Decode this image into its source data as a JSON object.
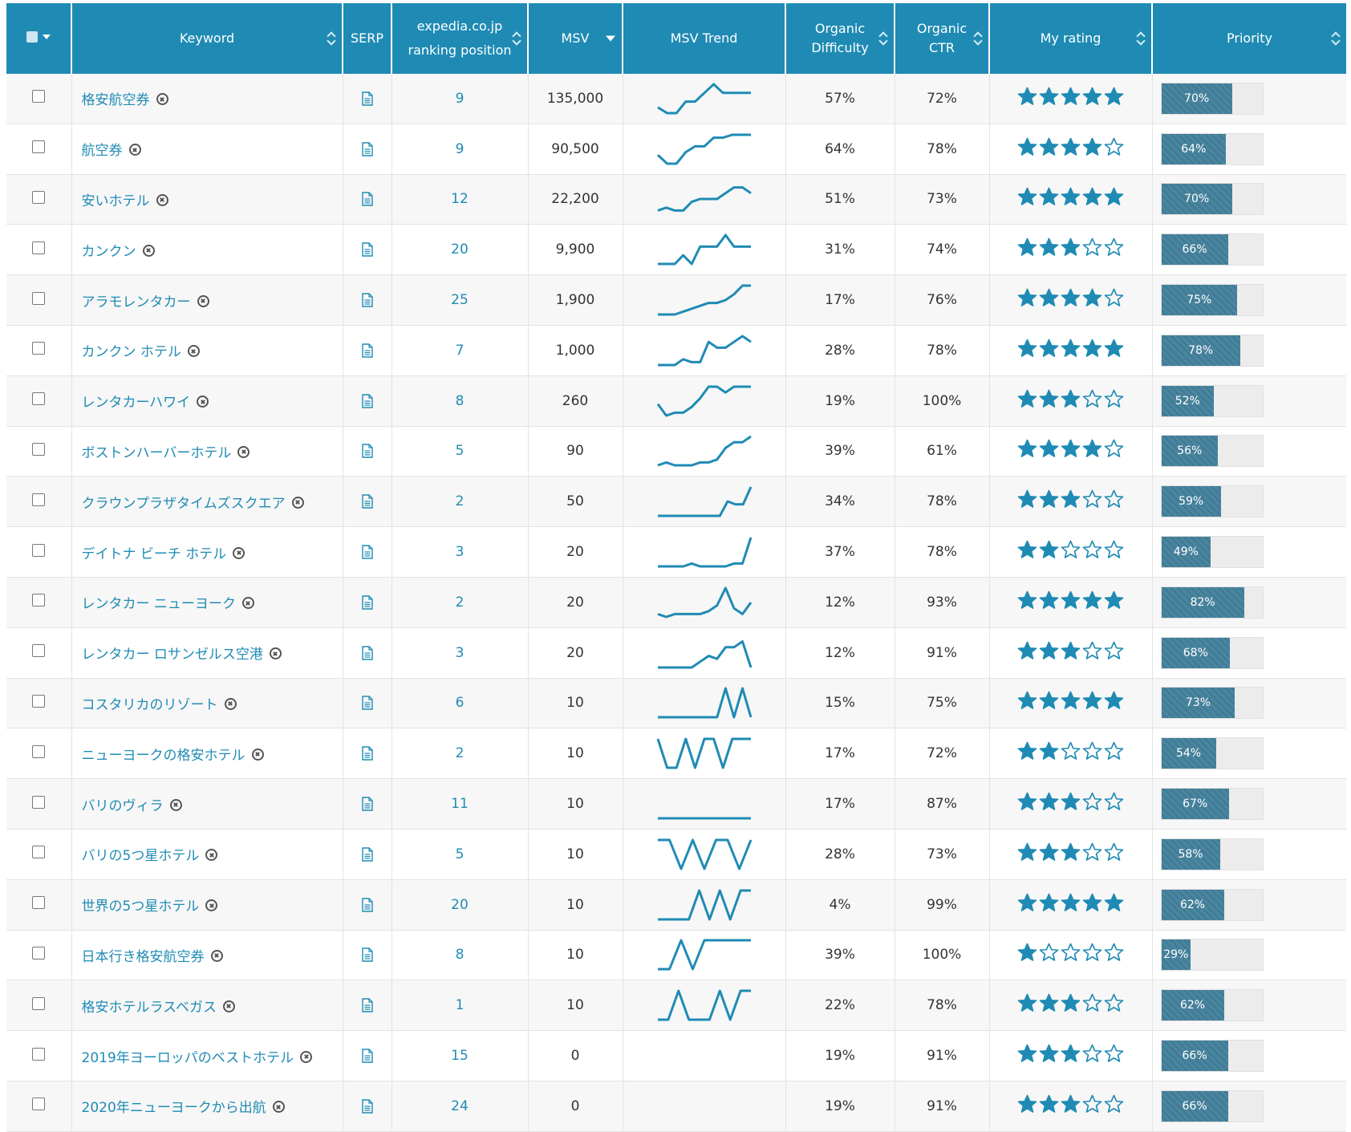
{
  "colors": {
    "accent": "#1f8bb4",
    "bar": "#3f7c97",
    "star": "#1f8bb4"
  },
  "header": {
    "keyword": "Keyword",
    "serp": "SERP",
    "ranking_line1": "expedia.co.jp",
    "ranking_line2": "ranking position",
    "msv": "MSV",
    "msv_trend": "MSV Trend",
    "difficulty_line1": "Organic",
    "difficulty_line2": "Difficulty",
    "ctr_line1": "Organic",
    "ctr_line2": "CTR",
    "rating": "My rating",
    "priority": "Priority"
  },
  "rows": [
    {
      "keyword": "格安航空券",
      "rank": "9",
      "msv": "135,000",
      "difficulty": "57%",
      "ctr": "72%",
      "rating": 5,
      "priority": 70,
      "priority_label": "70%",
      "trend": [
        2,
        0,
        0,
        4,
        4,
        7,
        10,
        7,
        7,
        7,
        7
      ]
    },
    {
      "keyword": "航空券",
      "rank": "9",
      "msv": "90,500",
      "difficulty": "64%",
      "ctr": "78%",
      "rating": 4,
      "priority": 64,
      "priority_label": "64%",
      "trend": [
        3,
        0,
        0,
        4,
        6,
        6,
        9,
        9,
        10,
        10,
        10
      ]
    },
    {
      "keyword": "安いホテル",
      "rank": "12",
      "msv": "22,200",
      "difficulty": "51%",
      "ctr": "73%",
      "rating": 5,
      "priority": 70,
      "priority_label": "70%",
      "trend": [
        1,
        2,
        1,
        1,
        4,
        5,
        5,
        5,
        7,
        9,
        9,
        7
      ]
    },
    {
      "keyword": "カンクン",
      "rank": "20",
      "msv": "9,900",
      "difficulty": "31%",
      "ctr": "74%",
      "rating": 3,
      "priority": 66,
      "priority_label": "66%",
      "trend": [
        0,
        0,
        0,
        3,
        0,
        6,
        6,
        6,
        10,
        6,
        6,
        6
      ]
    },
    {
      "keyword": "アラモレンタカー",
      "rank": "25",
      "msv": "1,900",
      "difficulty": "17%",
      "ctr": "76%",
      "rating": 4,
      "priority": 75,
      "priority_label": "75%",
      "trend": [
        0,
        0,
        0,
        1,
        2,
        3,
        4,
        4,
        5,
        7,
        10,
        10
      ]
    },
    {
      "keyword": "カンクン ホテル",
      "rank": "7",
      "msv": "1,000",
      "difficulty": "28%",
      "ctr": "78%",
      "rating": 5,
      "priority": 78,
      "priority_label": "78%",
      "trend": [
        0,
        0,
        0,
        2,
        1,
        1,
        8,
        6,
        6,
        8,
        10,
        8
      ]
    },
    {
      "keyword": "レンタカーハワイ",
      "rank": "8",
      "msv": "260",
      "difficulty": "19%",
      "ctr": "100%",
      "rating": 3,
      "priority": 52,
      "priority_label": "52%",
      "trend": [
        4,
        0,
        1,
        1,
        3,
        6,
        10,
        10,
        8,
        10,
        10,
        10
      ]
    },
    {
      "keyword": "ボストンハーバーホテル",
      "rank": "5",
      "msv": "90",
      "difficulty": "39%",
      "ctr": "61%",
      "rating": 4,
      "priority": 56,
      "priority_label": "56%",
      "trend": [
        0,
        1,
        0,
        0,
        0,
        1,
        1,
        2,
        6,
        8,
        8,
        10
      ]
    },
    {
      "keyword": "クラウンプラザタイムズスクエア",
      "rank": "2",
      "msv": "50",
      "difficulty": "34%",
      "ctr": "78%",
      "rating": 3,
      "priority": 59,
      "priority_label": "59%",
      "trend": [
        0,
        0,
        0,
        0,
        0,
        0,
        0,
        0,
        0,
        5,
        4,
        4,
        10
      ]
    },
    {
      "keyword": "デイトナ ビーチ ホテル",
      "rank": "3",
      "msv": "20",
      "difficulty": "37%",
      "ctr": "78%",
      "rating": 2,
      "priority": 49,
      "priority_label": "49%",
      "trend": [
        0,
        0,
        0,
        0,
        1,
        0,
        0,
        0,
        0,
        1,
        1,
        10
      ]
    },
    {
      "keyword": "レンタカー ニューヨーク",
      "rank": "2",
      "msv": "20",
      "difficulty": "12%",
      "ctr": "93%",
      "rating": 5,
      "priority": 82,
      "priority_label": "82%",
      "trend": [
        1,
        0,
        1,
        1,
        1,
        1,
        2,
        4,
        10,
        3,
        1,
        5
      ]
    },
    {
      "keyword": "レンタカー ロサンゼルス空港",
      "rank": "3",
      "msv": "20",
      "difficulty": "12%",
      "ctr": "91%",
      "rating": 3,
      "priority": 68,
      "priority_label": "68%",
      "trend": [
        0,
        0,
        0,
        0,
        0,
        2,
        4,
        3,
        7,
        7,
        9,
        0
      ]
    },
    {
      "keyword": "コスタリカのリゾート",
      "rank": "6",
      "msv": "10",
      "difficulty": "15%",
      "ctr": "75%",
      "rating": 5,
      "priority": 73,
      "priority_label": "73%",
      "trend": [
        0,
        0,
        0,
        0,
        0,
        0,
        0,
        0,
        10,
        0,
        10,
        0
      ]
    },
    {
      "keyword": "ニューヨークの格安ホテル",
      "rank": "2",
      "msv": "10",
      "difficulty": "17%",
      "ctr": "72%",
      "rating": 2,
      "priority": 54,
      "priority_label": "54%",
      "trend": [
        10,
        0,
        0,
        10,
        0,
        10,
        10,
        0,
        10,
        10,
        10
      ]
    },
    {
      "keyword": "バリのヴィラ",
      "rank": "11",
      "msv": "10",
      "difficulty": "17%",
      "ctr": "87%",
      "rating": 3,
      "priority": 67,
      "priority_label": "67%",
      "trend": [
        0,
        0,
        0,
        0,
        0,
        0,
        0,
        0,
        0,
        0,
        0
      ]
    },
    {
      "keyword": "バリの5つ星ホテル",
      "rank": "5",
      "msv": "10",
      "difficulty": "28%",
      "ctr": "73%",
      "rating": 3,
      "priority": 58,
      "priority_label": "58%",
      "trend": [
        10,
        10,
        0,
        10,
        0,
        10,
        10,
        0,
        10
      ]
    },
    {
      "keyword": "世界の5つ星ホテル",
      "rank": "20",
      "msv": "10",
      "difficulty": "4%",
      "ctr": "99%",
      "rating": 5,
      "priority": 62,
      "priority_label": "62%",
      "trend": [
        0,
        0,
        0,
        0,
        10,
        0,
        10,
        0,
        10,
        10
      ]
    },
    {
      "keyword": "日本行き格安航空券",
      "rank": "8",
      "msv": "10",
      "difficulty": "39%",
      "ctr": "100%",
      "rating": 1,
      "priority": 29,
      "priority_label": "29%",
      "trend": [
        0,
        0,
        10,
        0,
        10,
        10,
        10,
        10,
        10
      ]
    },
    {
      "keyword": "格安ホテルラスベガス",
      "rank": "1",
      "msv": "10",
      "difficulty": "22%",
      "ctr": "78%",
      "rating": 3,
      "priority": 62,
      "priority_label": "62%",
      "trend": [
        0,
        0,
        10,
        0,
        0,
        0,
        10,
        0,
        10,
        10
      ]
    },
    {
      "keyword": "2019年ヨーロッパのベストホテル",
      "rank": "15",
      "msv": "0",
      "difficulty": "19%",
      "ctr": "91%",
      "rating": 3,
      "priority": 66,
      "priority_label": "66%",
      "trend": []
    },
    {
      "keyword": "2020年ニューヨークから出航",
      "rank": "24",
      "msv": "0",
      "difficulty": "19%",
      "ctr": "91%",
      "rating": 3,
      "priority": 66,
      "priority_label": "66%",
      "trend": []
    }
  ]
}
